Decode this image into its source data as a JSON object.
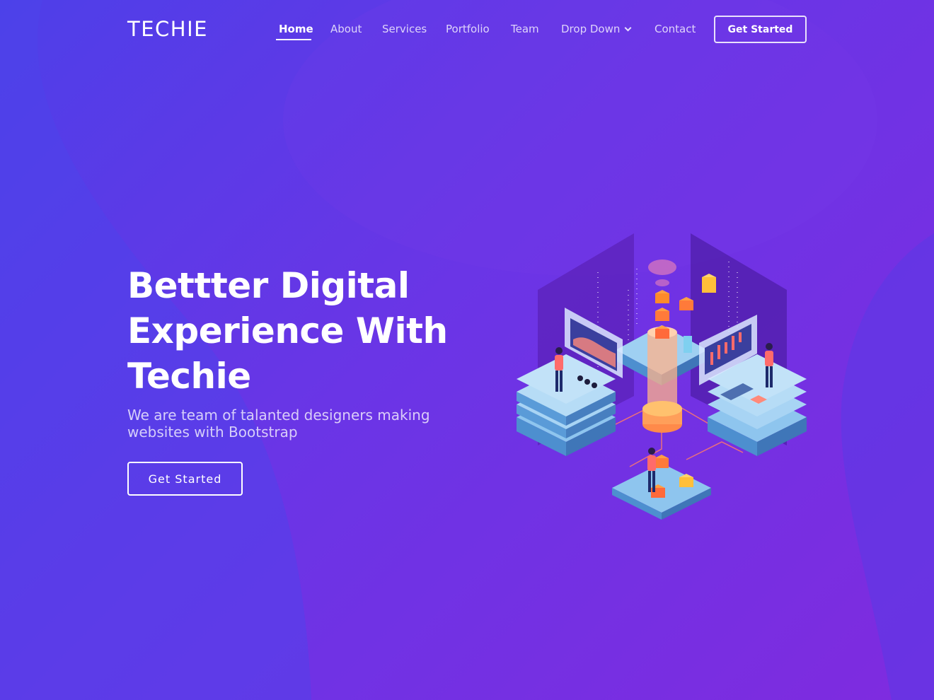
{
  "brand": {
    "logo": "TECHIE"
  },
  "nav": {
    "items": [
      {
        "label": "Home",
        "active": true
      },
      {
        "label": "About"
      },
      {
        "label": "Services"
      },
      {
        "label": "Portfolio"
      },
      {
        "label": "Team"
      },
      {
        "label": "Drop Down",
        "icon": "chevron-down-icon"
      },
      {
        "label": "Contact"
      }
    ],
    "cta_label": "Get Started"
  },
  "hero": {
    "title_line1": "Bettter Digital",
    "title_line2": "Experience With",
    "title_line3": "Techie",
    "subtitle_line1": "We are team of talanted designers making",
    "subtitle_line2": "websites with Bootstrap",
    "cta_label": "Get Started"
  },
  "colors": {
    "bg_start": "#4e3fe8",
    "bg_end": "#7f2bdf",
    "accent_orange": "#ff9f43",
    "accent_blue": "#8ec5ee"
  },
  "illustration": {
    "name": "isometric-data-center-illustration"
  }
}
